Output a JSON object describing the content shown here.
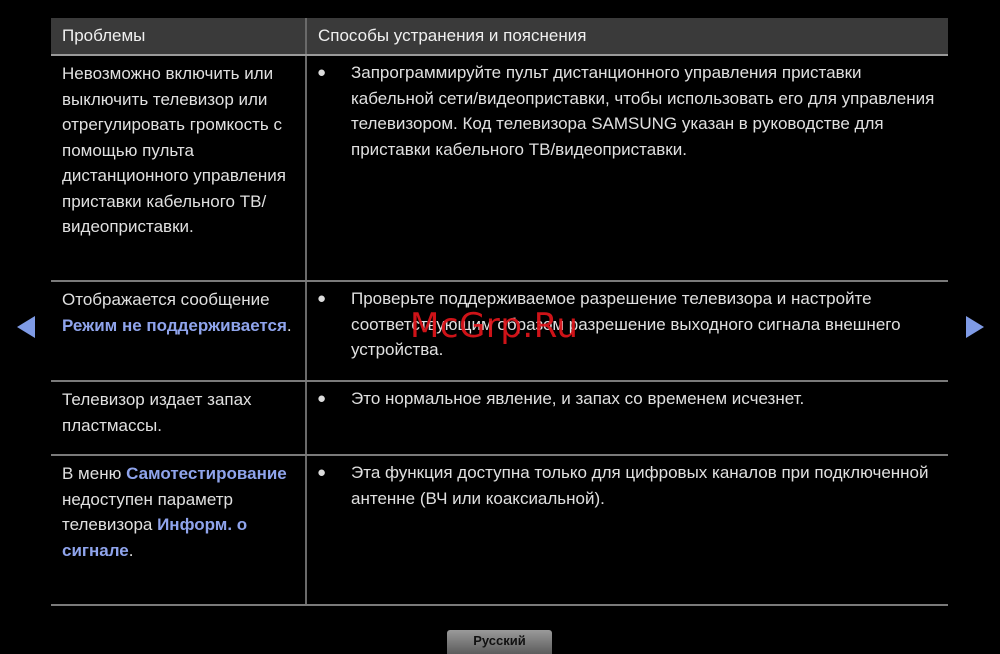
{
  "table": {
    "headers": {
      "problems": "Проблемы",
      "solutions": "Способы устранения и пояснения"
    },
    "rows": [
      {
        "problem": [
          {
            "text": "Невозможно включить или выключить телевизор или отрегулировать громкость с помощью пульта дистанционного управления приставки кабельного ТВ/ видеоприставки.",
            "hl": false
          }
        ],
        "solution": "Запрограммируйте пульт дистанционного управления приставки кабельной сети/видеоприставки, чтобы использовать его для управления телевизором. Код телевизора SAMSUNG указан в руководстве для приставки кабельного ТВ/видеоприставки."
      },
      {
        "problem": [
          {
            "text": "Отображается сообщение ",
            "hl": false
          },
          {
            "text": "Режим не поддерживается",
            "hl": true
          },
          {
            "text": ".",
            "hl": false
          }
        ],
        "solution": "Проверьте поддерживаемое разрешение телевизора и настройте соответствующим образом разрешение выходного сигнала внешнего устройства."
      },
      {
        "problem": [
          {
            "text": "Телевизор издает запах пластмассы.",
            "hl": false
          }
        ],
        "solution": "Это нормальное явление, и запах со временем исчезнет."
      },
      {
        "problem": [
          {
            "text": "В меню ",
            "hl": false
          },
          {
            "text": "Самотестирование",
            "hl": true
          },
          {
            "text": " недоступен параметр телевизора ",
            "hl": false
          },
          {
            "text": "Информ. о сигнале",
            "hl": true
          },
          {
            "text": ".",
            "hl": false
          }
        ],
        "solution": "Эта функция доступна только для цифровых каналов при подключенной антенне (ВЧ или коаксиальной)."
      }
    ]
  },
  "bullet_glyph": "●",
  "watermark": "McGrp.Ru",
  "language_tab": "Русский",
  "colors": {
    "highlight": "#8fa4ec",
    "arrow": "#7f9be6",
    "watermark": "#e0151b",
    "header_bg": "#3a3a3a"
  },
  "icons": {
    "prev": "triangle-left-icon",
    "next": "triangle-right-icon"
  }
}
